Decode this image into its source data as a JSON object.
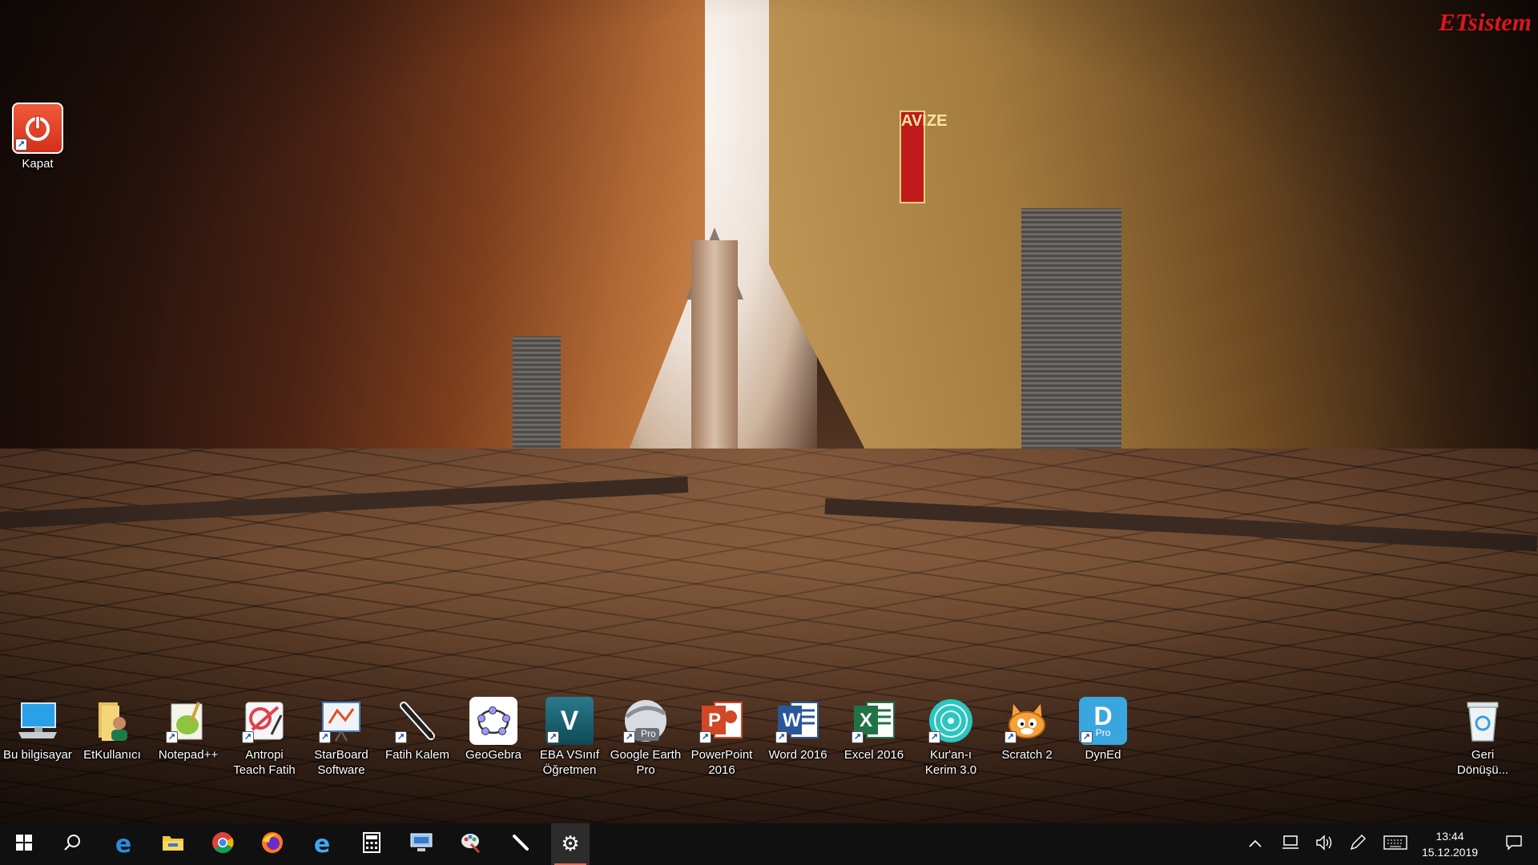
{
  "brand": {
    "text": "ETsistem",
    "color": "#e0141c"
  },
  "wallpaper": {
    "sign_text": "AVIZE"
  },
  "desktop": {
    "top_icons": [
      {
        "id": "kapat",
        "label": "Kapat",
        "icon": "power-icon"
      }
    ],
    "bottom_icons": [
      {
        "id": "bu-bilgisayar",
        "label": "Bu bilgisayar",
        "icon": "computer-icon"
      },
      {
        "id": "etkullanici",
        "label": "EtKullanıcı",
        "icon": "user-folder-icon"
      },
      {
        "id": "notepadpp",
        "label": "Notepad++",
        "icon": "notepad-plus-plus-icon"
      },
      {
        "id": "antropi",
        "label": "Antropi Teach Fatih",
        "icon": "antropi-teach-icon"
      },
      {
        "id": "starboard",
        "label": "StarBoard Software",
        "icon": "starboard-icon"
      },
      {
        "id": "fatih-kalem",
        "label": "Fatih Kalem",
        "icon": "pen-icon"
      },
      {
        "id": "geogebra",
        "label": "GeoGebra",
        "icon": "geogebra-icon"
      },
      {
        "id": "eba",
        "label": "EBA VSınıf Öğretmen",
        "icon": "eba-vsinif-icon"
      },
      {
        "id": "google-earth",
        "label": "Google Earth Pro",
        "icon": "google-earth-pro-icon"
      },
      {
        "id": "powerpoint",
        "label": "PowerPoint 2016",
        "icon": "powerpoint-icon"
      },
      {
        "id": "word",
        "label": "Word 2016",
        "icon": "word-icon"
      },
      {
        "id": "excel",
        "label": "Excel 2016",
        "icon": "excel-icon"
      },
      {
        "id": "kuran",
        "label": "Kur'an-ı Kerim 3.0",
        "icon": "kuran-kerim-icon"
      },
      {
        "id": "scratch",
        "label": "Scratch 2",
        "icon": "scratch-cat-icon"
      },
      {
        "id": "dyned",
        "label": "DynEd",
        "icon": "dyned-pro-icon"
      }
    ],
    "recycle_bin": {
      "label": "Geri Dönüşü...",
      "icon": "recycle-bin-icon"
    }
  },
  "icon_glyphs": {
    "eba": "V",
    "word": "W",
    "excel": "X",
    "powerpoint": "P",
    "dyned": "D",
    "pro": "Pro"
  },
  "taskbar": {
    "pinned": [
      {
        "name": "start-button",
        "icon": "windows-logo-icon"
      },
      {
        "name": "search-button",
        "icon": "search-icon"
      },
      {
        "name": "edge-button",
        "icon": "edge-icon"
      },
      {
        "name": "file-explorer-button",
        "icon": "folder-icon"
      },
      {
        "name": "chrome-button",
        "icon": "chrome-icon"
      },
      {
        "name": "firefox-button",
        "icon": "firefox-icon"
      },
      {
        "name": "ie-button",
        "icon": "internet-explorer-icon"
      },
      {
        "name": "calculator-button",
        "icon": "calculator-icon"
      },
      {
        "name": "remote-desktop-button",
        "icon": "remote-desktop-icon"
      },
      {
        "name": "paint-button",
        "icon": "paint-icon"
      },
      {
        "name": "pen-button",
        "icon": "pen-icon"
      },
      {
        "name": "settings-button",
        "icon": "gear-icon",
        "active": true
      }
    ],
    "tray": [
      {
        "name": "show-hidden-icons",
        "icon": "chevron-up-icon"
      },
      {
        "name": "network-icon",
        "icon": "network-icon"
      },
      {
        "name": "volume-icon",
        "icon": "speaker-icon"
      },
      {
        "name": "pen-workspace-icon",
        "icon": "pen-workspace-icon"
      },
      {
        "name": "touch-keyboard-icon",
        "icon": "keyboard-icon"
      }
    ],
    "clock": {
      "time": "13:44",
      "date": "15.12.2019"
    },
    "action_center": {
      "icon": "notification-icon"
    }
  }
}
